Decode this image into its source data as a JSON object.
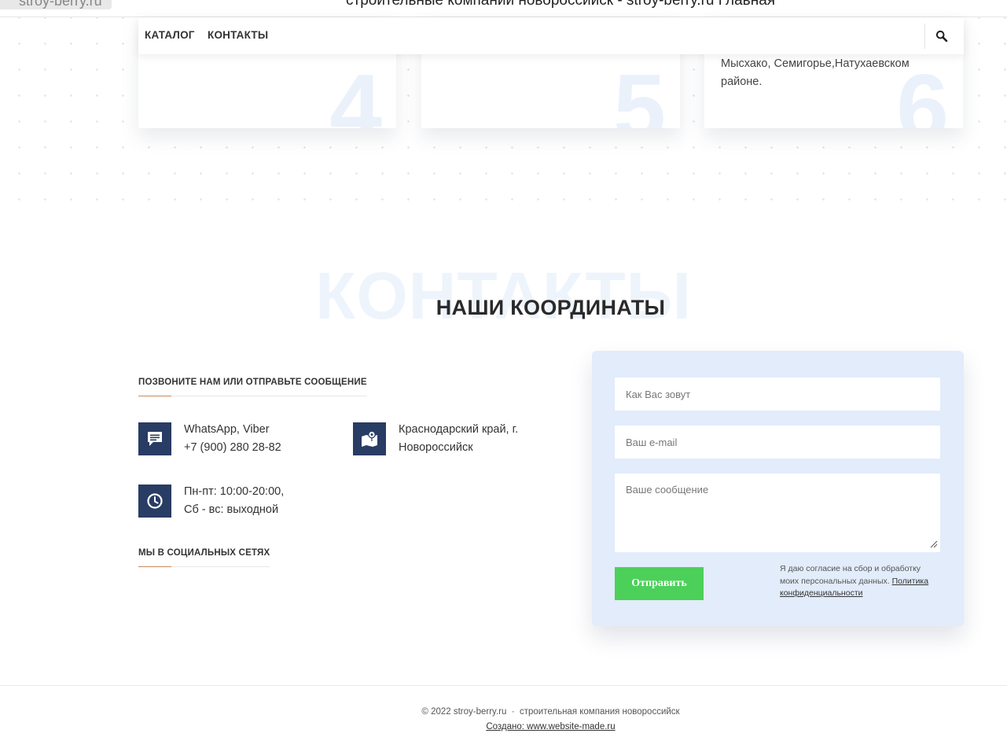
{
  "header": {
    "site_tag": "stroy-berry.ru",
    "page_title": "строительные компании новороссийск - stroy-berry.ru Главная"
  },
  "cards": [
    {
      "number": "4",
      "text": ""
    },
    {
      "number": "5",
      "text": ""
    },
    {
      "number": "6",
      "text": "Мысхако, Семигорье,Натухаевском районе."
    }
  ],
  "navbar": {
    "items": [
      {
        "label": "КАТАЛОГ"
      },
      {
        "label": "КОНТАКТЫ"
      }
    ],
    "search_icon": "search-icon"
  },
  "contacts": {
    "bg_word": "КОНТАКТЫ",
    "title": "НАШИ КООРДИНАТЫ",
    "call_heading": "ПОЗВОНИТЕ НАМ ИЛИ ОТПРАВЬТЕ СООБЩЕНИЕ",
    "phone_line1": "WhatsApp, Viber",
    "phone_line2": "+7 (900) 280 28-82",
    "address_line1": "Краснодарский край, г.",
    "address_line2": "Новороссийск",
    "hours_line1": "Пн-пт: 10:00-20:00,",
    "hours_line2": "Сб - вс: выходной",
    "social_heading": "МЫ В СОЦИАЛЬНЫХ СЕТЯХ",
    "icon_color": "#283c64"
  },
  "form": {
    "name_placeholder": "Как Вас зовут",
    "email_placeholder": "Ваш e-mail",
    "message_placeholder": "Ваше сообщение",
    "submit_label": "Отправить",
    "consent_text": "Я даю согласие на сбор и обработку моих персональных данных. ",
    "privacy_link": "Политика конфиденциальности",
    "panel_color": "#e2ecfa",
    "submit_color": "#4cd05a"
  },
  "footer": {
    "copyright": "© 2022 stroy-berry.ru",
    "separator": "·",
    "tagline": "строительная компания новороссийск",
    "made_by": "Создано: www.website-made.ru"
  }
}
